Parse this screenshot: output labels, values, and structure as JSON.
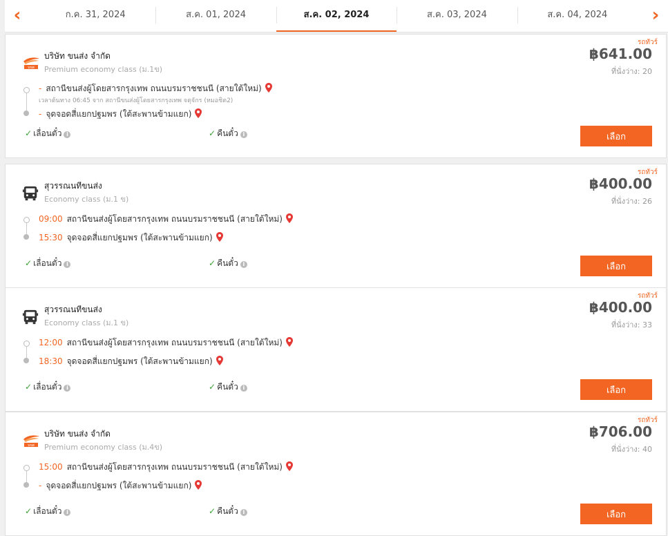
{
  "dates": [
    "ก.ค. 31, 2024",
    "ส.ค. 01, 2024",
    "ส.ค. 02, 2024",
    "ส.ค. 03, 2024",
    "ส.ค. 04, 2024"
  ],
  "active_date_index": 2,
  "nav": {
    "prev_icon": "chevron-left",
    "next_icon": "chevron-right"
  },
  "labels": {
    "refund": "เลื่อนตั๋ว",
    "return": "คืนตั๋ว",
    "select": "เลือก",
    "check_icon": "check-icon",
    "info_icon": "info-icon"
  },
  "accent": "#f26522",
  "trips": [
    {
      "badge": "รถทัวร์",
      "logo": "bor-kor-sor-logo",
      "operator": "บริษัท ขนส่ง จำกัด",
      "class": "Premium economy class (ม.1ข)",
      "price": "฿641.00",
      "seats": "ที่นั่งว่าง: 20",
      "depart_time": "-",
      "depart": "สถานีขนส่งผู้โดยสารกรุงเทพ ถนนบรมราชชนนี (สายใต้ใหม่)",
      "note": "เวลาต้นทาง 06:45   จาก สถานีขนส่งผู้โดยสารกรุงเทพ จตุจักร (หมอชิต2)",
      "arrive_time": "-",
      "arrive": "จุดจอดสี่แยกปฐมพร (ใต้สะพานข้ามแยก)"
    },
    {
      "badge": "รถทัวร์",
      "logo": "bus-icon",
      "operator": "สุวรรณนทีขนส่ง",
      "class": "Economy class (ม.1 ข)",
      "price": "฿400.00",
      "seats": "ที่นั่งว่าง: 26",
      "depart_time": "09:00",
      "depart": "สถานีขนส่งผู้โดยสารกรุงเทพ ถนนบรมราชชนนี (สายใต้ใหม่)",
      "note": "",
      "arrive_time": "15:30",
      "arrive": "จุดจอดสี่แยกปฐมพร (ใต้สะพานข้ามแยก)"
    },
    {
      "badge": "รถทัวร์",
      "logo": "bus-icon",
      "operator": "สุวรรณนทีขนส่ง",
      "class": "Economy class (ม.1 ข)",
      "price": "฿400.00",
      "seats": "ที่นั่งว่าง: 33",
      "depart_time": "12:00",
      "depart": "สถานีขนส่งผู้โดยสารกรุงเทพ ถนนบรมราชชนนี (สายใต้ใหม่)",
      "note": "",
      "arrive_time": "18:30",
      "arrive": "จุดจอดสี่แยกปฐมพร (ใต้สะพานข้ามแยก)"
    },
    {
      "badge": "รถทัวร์",
      "logo": "bor-kor-sor-logo",
      "operator": "บริษัท ขนส่ง จำกัด",
      "class": "Premium economy class (ม.4ข)",
      "price": "฿706.00",
      "seats": "ที่นั่งว่าง: 40",
      "depart_time": "15:00",
      "depart": "สถานีขนส่งผู้โดยสารกรุงเทพ ถนนบรมราชชนนี (สายใต้ใหม่)",
      "note": "",
      "arrive_time": "-",
      "arrive": "จุดจอดสี่แยกปฐมพร (ใต้สะพานข้ามแยก)"
    }
  ]
}
